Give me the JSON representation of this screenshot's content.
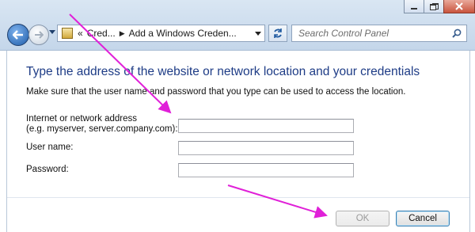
{
  "window": {
    "controls": [
      "minimize",
      "maximize",
      "close"
    ]
  },
  "navigation": {
    "breadcrumb_overflow": "«",
    "breadcrumb": [
      "Cred...",
      "Add a Windows Creden..."
    ],
    "search_placeholder": "Search Control Panel"
  },
  "form": {
    "heading": "Type the address of the website or network location and your credentials",
    "description": "Make sure that the user name and password that you type can be used to access the location.",
    "address_label_line1": "Internet or network address",
    "address_label_line2": "(e.g. myserver, server.company.com):",
    "address_value": "",
    "username_label": "User name:",
    "username_value": "",
    "password_label": "Password:",
    "password_value": ""
  },
  "buttons": {
    "ok_label": "OK",
    "ok_enabled": false,
    "cancel_label": "Cancel"
  },
  "colors": {
    "heading": "#1e3c86",
    "annotation_arrow": "#e020d8"
  }
}
